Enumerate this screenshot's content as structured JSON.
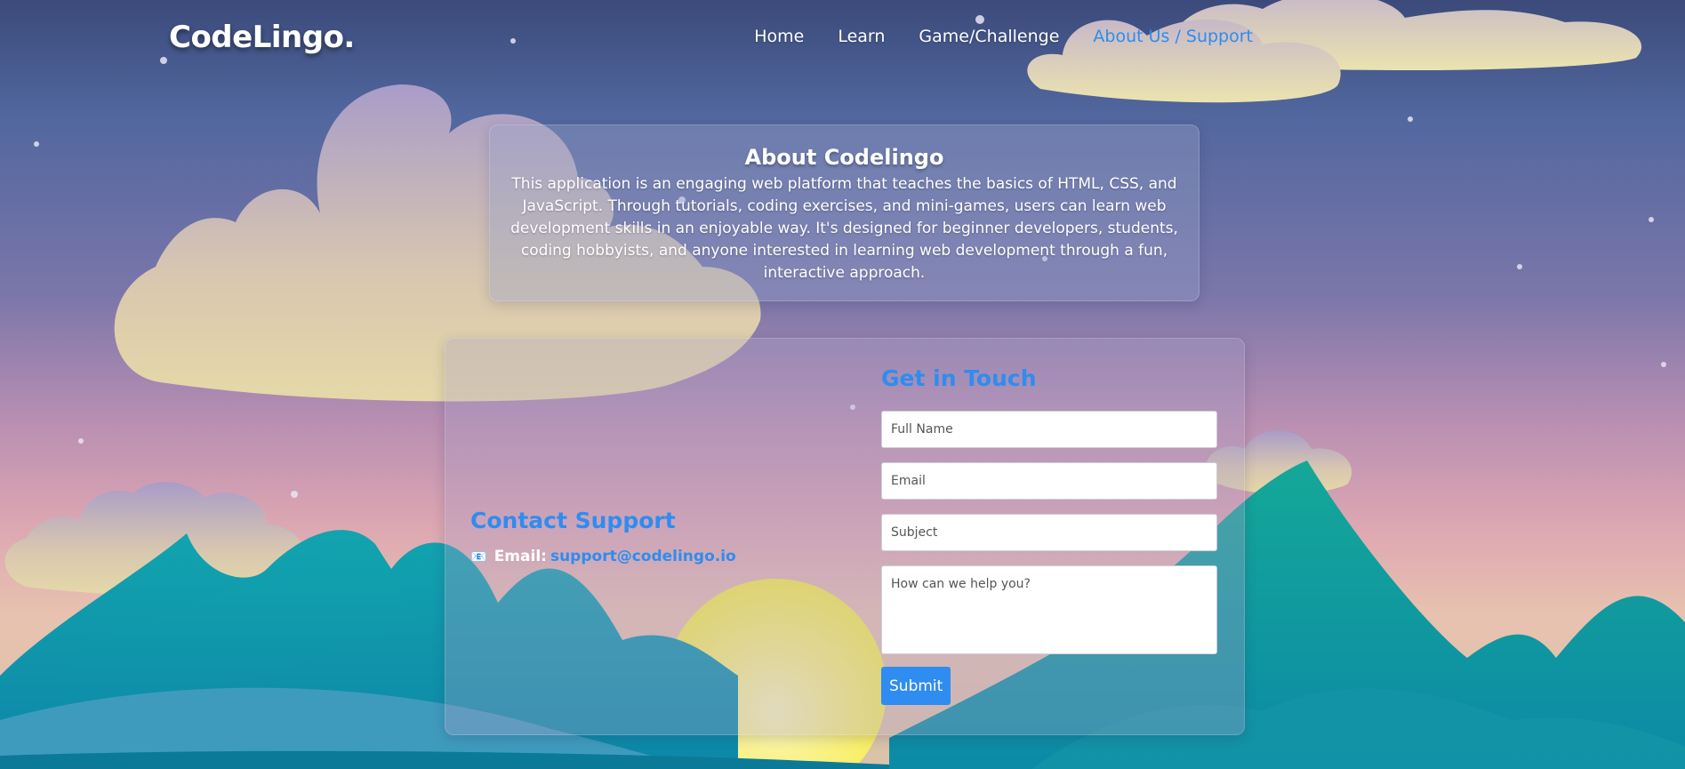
{
  "header": {
    "logo": "CodeLingo.",
    "nav": [
      {
        "label": "Home",
        "active": false
      },
      {
        "label": "Learn",
        "active": false
      },
      {
        "label": "Game/Challenge",
        "active": false
      },
      {
        "label": "About Us / Support",
        "active": true
      }
    ]
  },
  "about": {
    "title": "About Codelingo",
    "body": "This application is an engaging web platform that teaches the basics of HTML, CSS, and JavaScript. Through tutorials, coding exercises, and mini-games, users can learn web development skills in an enjoyable way. It's designed for beginner developers, students, coding hobbyists, and anyone interested in learning web development through a fun, interactive approach."
  },
  "support": {
    "title": "Contact Support",
    "email_label": "Email:",
    "email": "support@codelingo.io"
  },
  "form": {
    "title": "Get in Touch",
    "name_placeholder": "Full Name",
    "email_placeholder": "Email",
    "subject_placeholder": "Subject",
    "message_placeholder": "How can we help you?",
    "submit_label": "Submit"
  },
  "colors": {
    "accent": "#2f8cf0",
    "sky_top": "#3b4a7a",
    "mountain": "#14a3b0",
    "sun": "#f7ee55",
    "cloud": "#e3d6a8"
  }
}
